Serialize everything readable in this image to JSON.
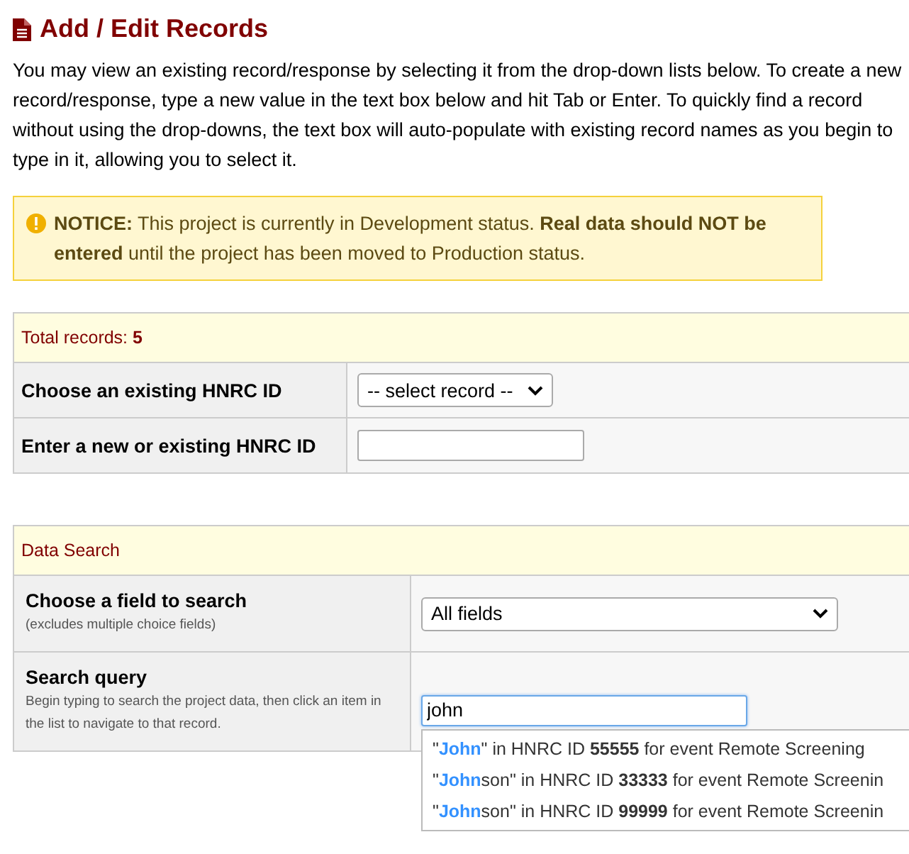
{
  "page_title": "Add / Edit Records",
  "intro": "You may view an existing record/response by selecting it from the drop-down lists below. To create a new record/response, type a new value in the text box below and hit Tab or Enter. To quickly find a record without using the drop-downs, the text box will auto-populate with existing record names as you begin to type in it, allowing you to select it.",
  "notice": "**NOTICE:** This project is currently in Development status. **Real data should NOT be entered** until the project has been moved to Production status.",
  "records_panel": {
    "header": "Total records: **5**",
    "rows": [
      {
        "kind": "select",
        "label": "Choose an existing HNRC ID",
        "value": "-- select record --"
      },
      {
        "kind": "input",
        "label": "Enter a new or existing HNRC ID",
        "value": ""
      }
    ]
  },
  "search_panel": {
    "header": "Data Search",
    "rows": [
      {
        "kind": "select",
        "label": "Choose a field to search",
        "note": "(excludes multiple choice fields)",
        "value": "All fields"
      },
      {
        "kind": "query",
        "label": "Search query",
        "note": "Begin typing to search the project data, then click an item in the list to navigate to that record.",
        "value": "john"
      }
    ],
    "suggestions": [
      {
        "open": "\"",
        "match": "John",
        "rest": "\" in HNRC ID",
        "record_id": "55555",
        "tail": "for event Remote Screening"
      },
      {
        "open": "\"",
        "match": "John",
        "rest": "son\" in HNRC ID",
        "record_id": "33333",
        "tail": "for event Remote Screenin"
      },
      {
        "open": "\"",
        "match": "John",
        "rest": "son\" in HNRC ID",
        "record_id": "99999",
        "tail": "for event Remote Screenin"
      }
    ]
  }
}
